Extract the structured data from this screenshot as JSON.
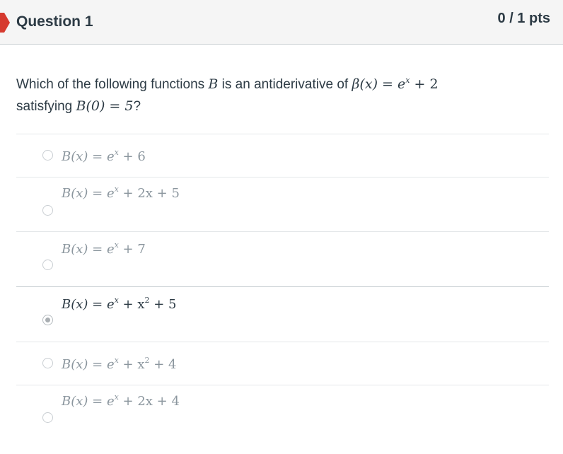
{
  "question": {
    "title": "Question 1",
    "points": "0 / 1 pts",
    "text_prefix": "Which of the following functions",
    "var_B": "B",
    "text_mid": "is an antiderivative of",
    "beta_expr": "β(x) = e",
    "beta_exp": "x",
    "beta_tail": " + 2",
    "text_line2_prefix": "satisfying",
    "condition": "B(0) = 5",
    "question_mark": "?"
  },
  "answers": [
    {
      "lhs": "B(x) = e",
      "exp": "x",
      "rhs": " + 6",
      "selected": false
    },
    {
      "lhs": "B(x) = e",
      "exp": "x",
      "rhs": " + 2x + 5",
      "selected": false
    },
    {
      "lhs": "B(x) = e",
      "exp": "x",
      "rhs": " + 7",
      "selected": false
    },
    {
      "lhs": "B(x) = e",
      "exp": "x",
      "rhs_pre": " + x",
      "exp2": "2",
      "rhs": " + 5",
      "selected": true
    },
    {
      "lhs": "B(x) = e",
      "exp": "x",
      "rhs_pre": " + x",
      "exp2": "2",
      "rhs": " + 4",
      "selected": false
    },
    {
      "lhs": "B(x) = e",
      "exp": "x",
      "rhs": " + 2x + 4",
      "selected": false
    }
  ],
  "colors": {
    "header_bg": "#f5f5f5",
    "flag": "#d63a2f",
    "text": "#2d3b45",
    "unselected_text": "#8b969e"
  }
}
